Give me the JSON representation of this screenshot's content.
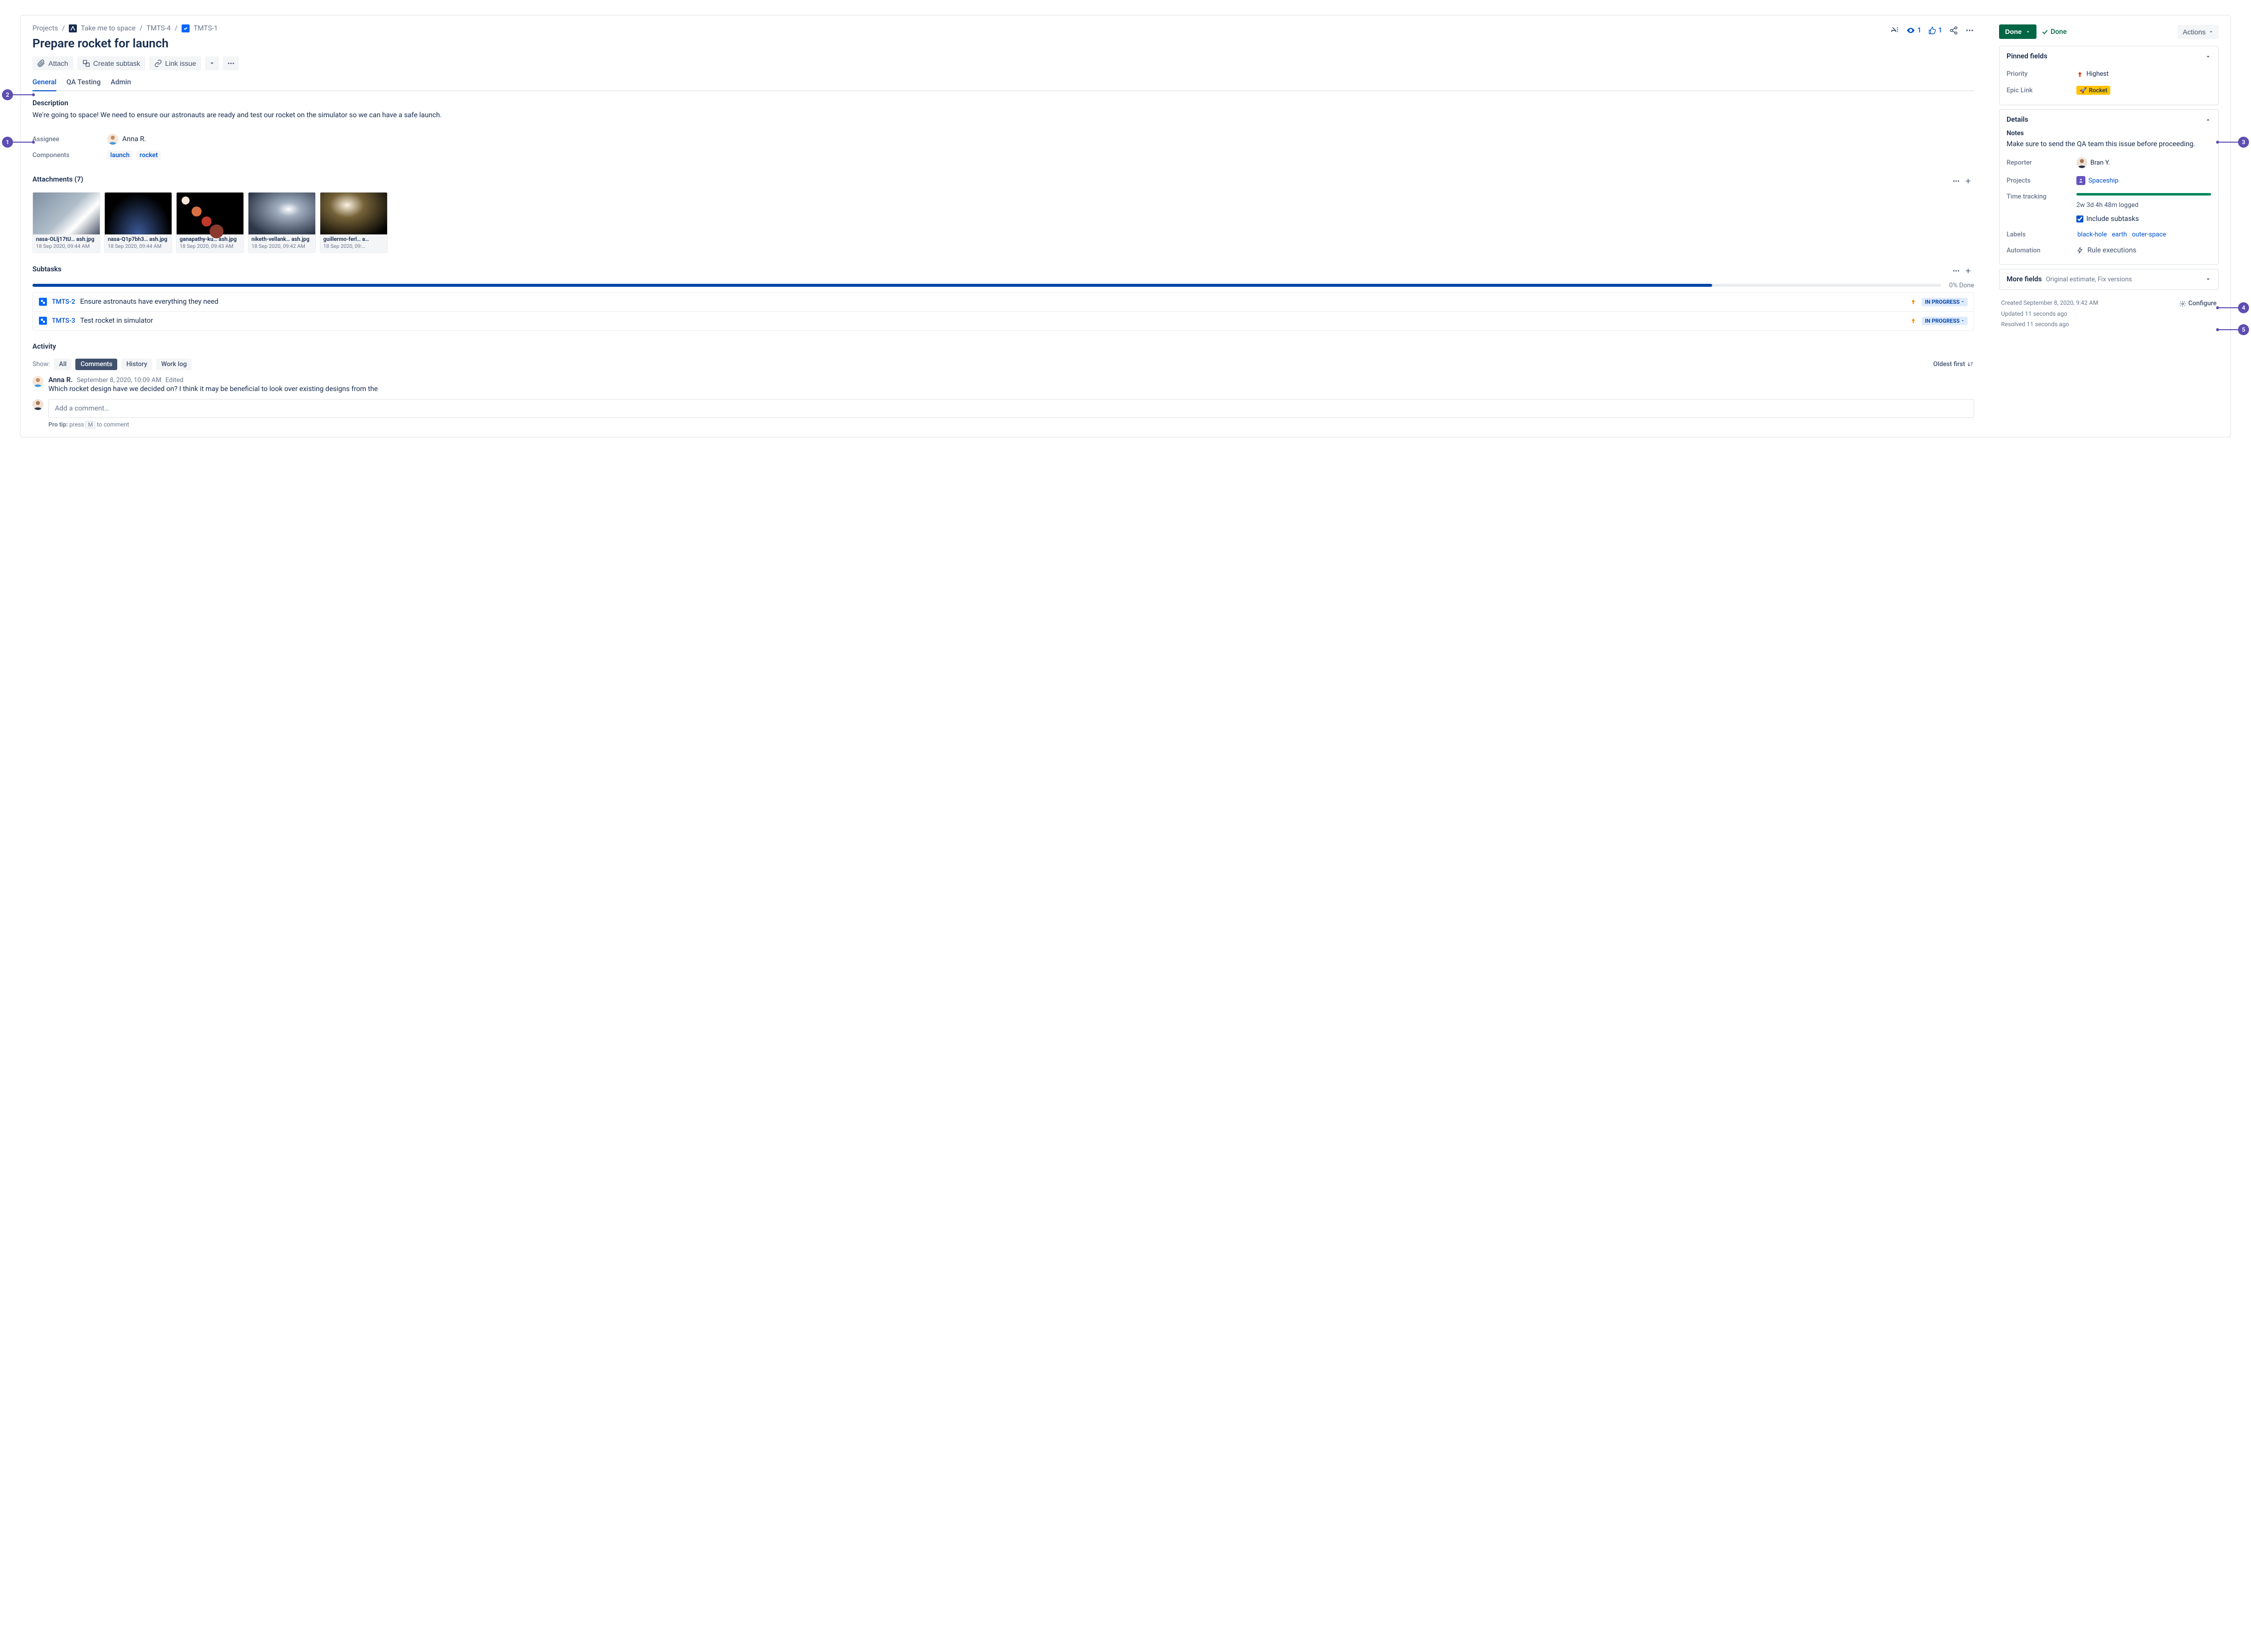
{
  "breadcrumb": {
    "root": "Projects",
    "project": "Take me to space",
    "parent_key": "TMTS-4",
    "issue_key": "TMTS-1"
  },
  "header_actions": {
    "watchers": "1",
    "likes": "1"
  },
  "issue": {
    "title": "Prepare rocket for launch"
  },
  "toolbar": {
    "attach": "Attach",
    "create_subtask": "Create subtask",
    "link_issue": "Link issue"
  },
  "tabs": {
    "general": "General",
    "qa": "QA Testing",
    "admin": "Admin"
  },
  "content": {
    "description_heading": "Description",
    "description": "We're going to space! We need to ensure our astronauts are ready and test our rocket on the simulator so we can have a safe launch.",
    "assignee_label": "Assignee",
    "assignee": "Anna R.",
    "components_label": "Components",
    "components": [
      "launch",
      "rocket"
    ]
  },
  "attachments": {
    "heading": "Attachments (7)",
    "items": [
      {
        "file": "nasa-OLlj17tU… ash.jpg",
        "date": "18 Sep 2020, 09:44 AM"
      },
      {
        "file": "nasa-Q1p7bh3… ash.jpg",
        "date": "18 Sep 2020, 09:44 AM"
      },
      {
        "file": "ganapathy-ku… ash.jpg",
        "date": "18 Sep 2020, 09:43 AM"
      },
      {
        "file": "niketh-vellank… ash.jpg",
        "date": "18 Sep 2020, 09:42 AM"
      },
      {
        "file": "guillermo-ferl… a…",
        "date": "18 Sep 2020, 09:…"
      }
    ]
  },
  "subtasks": {
    "heading": "Subtasks",
    "progress_label": "0% Done",
    "items": [
      {
        "key": "TMTS-2",
        "summary": "Ensure astronauts have everything they need",
        "status": "IN PROGRESS"
      },
      {
        "key": "TMTS-3",
        "summary": "Test rocket in simulator",
        "status": "IN PROGRESS"
      }
    ]
  },
  "activity": {
    "heading": "Activity",
    "show_label": "Show:",
    "filters": {
      "all": "All",
      "comments": "Comments",
      "history": "History",
      "worklog": "Work log"
    },
    "sort": "Oldest first",
    "comment": {
      "author": "Anna R.",
      "timestamp": "September 8, 2020, 10:09 AM",
      "edited": "Edited",
      "text": "Which rocket design have we decided on? I think it may be beneficial to look over existing designs from the"
    },
    "add_placeholder": "Add a comment…",
    "protip_prefix": "Pro tip:",
    "protip_text": " press ",
    "protip_key": "M",
    "protip_suffix": " to comment"
  },
  "status": {
    "done_button": "Done",
    "resolution": "Done",
    "actions": "Actions"
  },
  "pinned": {
    "heading": "Pinned fields",
    "priority_label": "Priority",
    "priority": "Highest",
    "epic_label": "Epic Link",
    "epic": "Rocket"
  },
  "details": {
    "heading": "Details",
    "notes_label": "Notes",
    "notes": "Make sure to send the QA team this issue before proceeding.",
    "reporter_label": "Reporter",
    "reporter": "Bran Y.",
    "projects_label": "Projects",
    "projects": "Spaceship",
    "time_label": "Time tracking",
    "time_logged": "2w 3d 4h 48m logged",
    "include_subtasks": "Include subtasks",
    "labels_label": "Labels",
    "labels": [
      "black-hole",
      "earth",
      "outer-space"
    ],
    "automation_label": "Automation",
    "automation_value": "Rule executions"
  },
  "more_fields": {
    "heading": "More fields",
    "subtitle": "Original estimate, Fix versions"
  },
  "meta": {
    "created": "Created September 8, 2020, 9:42 AM",
    "updated": "Updated 11 seconds ago",
    "resolved": "Resolved 11 seconds ago",
    "configure": "Configure"
  },
  "annotations": {
    "a1": "1",
    "a2": "2",
    "a3": "3",
    "a4": "4",
    "a5": "5"
  }
}
